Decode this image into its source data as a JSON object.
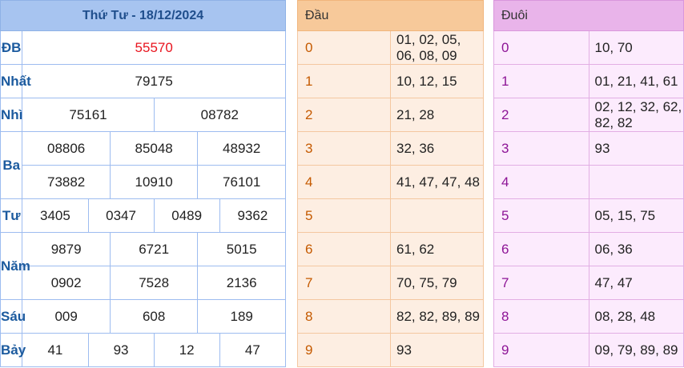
{
  "header": {
    "title": "Thứ Tư - 18/12/2024"
  },
  "prizes": {
    "db": {
      "label": "ĐB",
      "values": [
        "55570"
      ]
    },
    "nhat": {
      "label": "Nhất",
      "values": [
        "79175"
      ]
    },
    "nhi": {
      "label": "Nhì",
      "values": [
        "75161",
        "08782"
      ]
    },
    "ba": {
      "label": "Ba",
      "values": [
        "08806",
        "85048",
        "48932",
        "73882",
        "10910",
        "76101"
      ]
    },
    "tu": {
      "label": "Tư",
      "values": [
        "3405",
        "0347",
        "0489",
        "9362"
      ]
    },
    "nam": {
      "label": "Năm",
      "values": [
        "9879",
        "6721",
        "5015",
        "0902",
        "7528",
        "2136"
      ]
    },
    "sau": {
      "label": "Sáu",
      "values": [
        "009",
        "608",
        "189"
      ]
    },
    "bay": {
      "label": "Bảy",
      "values": [
        "41",
        "93",
        "12",
        "47"
      ]
    }
  },
  "dau": {
    "header": "Đầu",
    "rows": [
      {
        "digit": "0",
        "values": "01, 02, 05, 06, 08, 09"
      },
      {
        "digit": "1",
        "values": "10, 12, 15"
      },
      {
        "digit": "2",
        "values": "21, 28"
      },
      {
        "digit": "3",
        "values": "32, 36"
      },
      {
        "digit": "4",
        "values": "41, 47, 47, 48"
      },
      {
        "digit": "5",
        "values": ""
      },
      {
        "digit": "6",
        "values": "61, 62"
      },
      {
        "digit": "7",
        "values": "70, 75, 79"
      },
      {
        "digit": "8",
        "values": "82, 82, 89, 89"
      },
      {
        "digit": "9",
        "values": "93"
      }
    ]
  },
  "duoi": {
    "header": "Đuôi",
    "rows": [
      {
        "digit": "0",
        "values": "10, 70"
      },
      {
        "digit": "1",
        "values": "01, 21, 41, 61"
      },
      {
        "digit": "2",
        "values": "02, 12, 32, 62, 82, 82"
      },
      {
        "digit": "3",
        "values": "93"
      },
      {
        "digit": "4",
        "values": ""
      },
      {
        "digit": "5",
        "values": "05, 15, 75"
      },
      {
        "digit": "6",
        "values": "06, 36"
      },
      {
        "digit": "7",
        "values": "47, 47"
      },
      {
        "digit": "8",
        "values": "08, 28, 48"
      },
      {
        "digit": "9",
        "values": "09, 79, 89, 89"
      }
    ]
  }
}
